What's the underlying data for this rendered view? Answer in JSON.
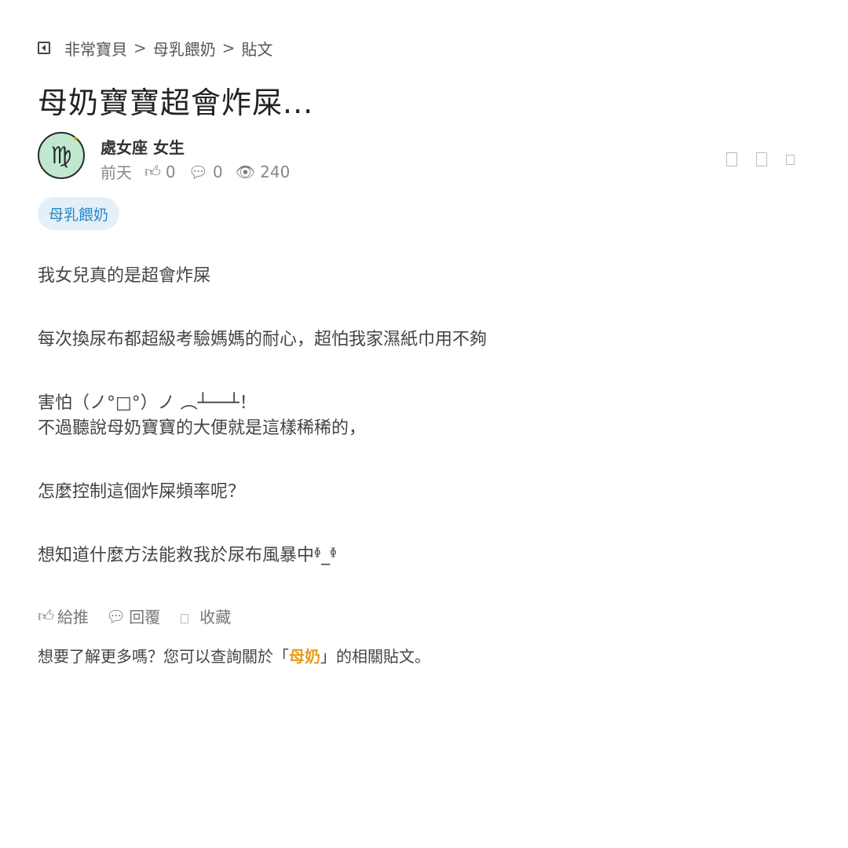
{
  "breadcrumb": {
    "items": [
      "非常寶貝",
      "母乳餵奶",
      "貼文"
    ],
    "separator": ">"
  },
  "post": {
    "title": "母奶寶寶超會炸屎...",
    "author": "處女座 女生",
    "avatar_symbol": "♍",
    "time": "前天",
    "likes": "0",
    "comments": "0",
    "views": "240",
    "tag": "母乳餵奶",
    "body": [
      "我女兒真的是超會炸屎",
      "每次換尿布都超級考驗媽媽的耐心，超怕我家濕紙巾用不夠",
      "害怕（ノ°□°）ノ ︵┴──┴！",
      "不過聽說母奶寶寶的大便就是這樣稀稀的，",
      "怎麼控制這個炸屎頻率呢？",
      "想知道什麼方法能救我於尿布風暴中ᶲ_ᶲ"
    ]
  },
  "footer": {
    "like_label": "給推",
    "reply_label": "回覆",
    "save_label": "收藏",
    "more_prefix": "想要了解更多嗎？您可以查詢關於「",
    "more_keyword": "母奶",
    "more_suffix": "」的相關貼文。"
  },
  "icons": {
    "back": "back-arrow-icon",
    "like": "thumbs-up-icon",
    "comment": "speech-bubble-icon",
    "views": "eye-icon"
  },
  "colors": {
    "tag_bg": "#e3f0fa",
    "tag_text": "#2b86c5",
    "keyword": "#e89a1c",
    "avatar_bg": "#bfe8cf"
  }
}
